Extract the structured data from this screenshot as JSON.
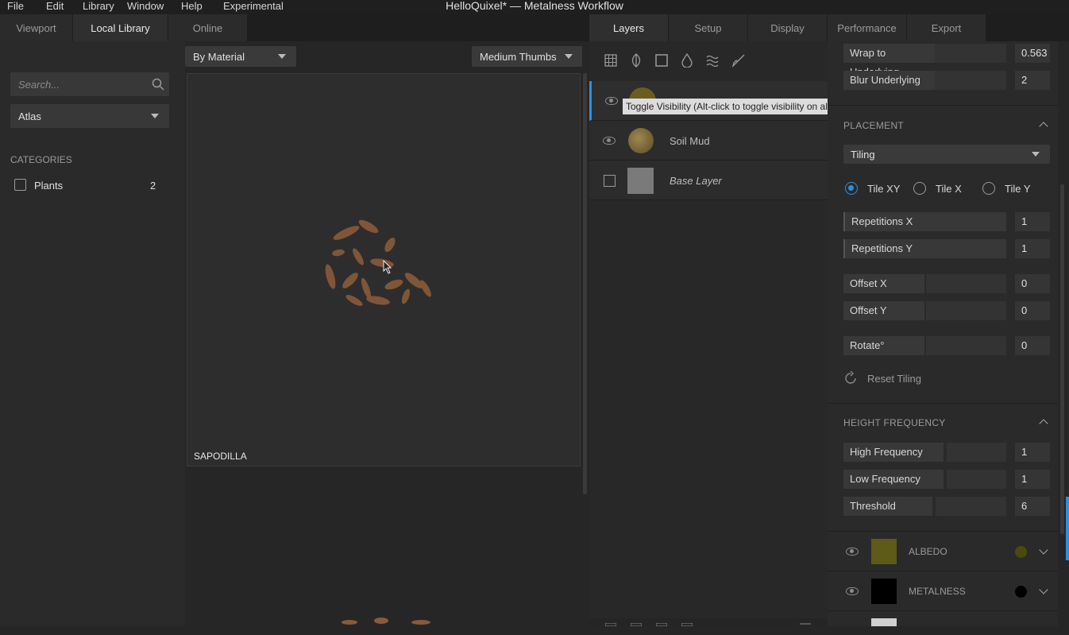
{
  "menu": [
    "File",
    "Edit",
    "Library",
    "Window",
    "Help",
    "Experimental"
  ],
  "app_title": "HelloQuixel* — Metalness Workflow",
  "left_tabs": [
    {
      "label": "Viewport"
    },
    {
      "label": "Local Library",
      "active": true
    },
    {
      "label": "Online"
    }
  ],
  "right_tabs": [
    {
      "label": "Layers",
      "active": true
    },
    {
      "label": "Setup"
    },
    {
      "label": "Display"
    },
    {
      "label": "Performance"
    },
    {
      "label": "Export"
    }
  ],
  "sidebar": {
    "search_placeholder": "Search...",
    "collection": "Atlas",
    "categories_title": "CATEGORIES",
    "categories": [
      {
        "label": "Plants",
        "count": "2"
      }
    ]
  },
  "library": {
    "sort_by": "By Material",
    "thumb_size": "Medium Thumbs",
    "items": [
      {
        "name": "SAPODILLA"
      }
    ]
  },
  "layers": {
    "tooltip": "Toggle Visibility (Alt-click to toggle visibility on all other items.)",
    "rows": [
      {
        "name": "",
        "selected": true
      },
      {
        "name": "Soil Mud"
      },
      {
        "name": "Base Layer"
      }
    ]
  },
  "props": {
    "blend": [
      {
        "label": "Wrap to Underlying",
        "value": "0.563"
      },
      {
        "label": "Blur Underlying",
        "value": "2"
      }
    ],
    "placement": {
      "title": "PLACEMENT",
      "mode": "Tiling",
      "radios": [
        {
          "label": "Tile XY",
          "checked": true
        },
        {
          "label": "Tile X"
        },
        {
          "label": "Tile Y"
        }
      ],
      "fields": [
        {
          "label": "Repetitions X",
          "value": "1"
        },
        {
          "label": "Repetitions Y",
          "value": "1"
        },
        {
          "label": "Offset X",
          "value": "0"
        },
        {
          "label": "Offset Y",
          "value": "0"
        },
        {
          "label": "Rotate°",
          "value": "0"
        }
      ],
      "reset_label": "Reset Tiling"
    },
    "height_frequency": {
      "title": "HEIGHT FREQUENCY",
      "fields": [
        {
          "label": "High Frequency",
          "value": "1"
        },
        {
          "label": "Low Frequency",
          "value": "1"
        },
        {
          "label": "Threshold",
          "value": "6"
        }
      ]
    },
    "channels": [
      {
        "label": "ALBEDO",
        "color": "#4a4a10"
      },
      {
        "label": "METALNESS",
        "color": "#000000"
      }
    ]
  },
  "colors": {
    "accent": "#2f8ee0",
    "panel": "#2a2a2a",
    "leaf": "#8a5a3a"
  }
}
